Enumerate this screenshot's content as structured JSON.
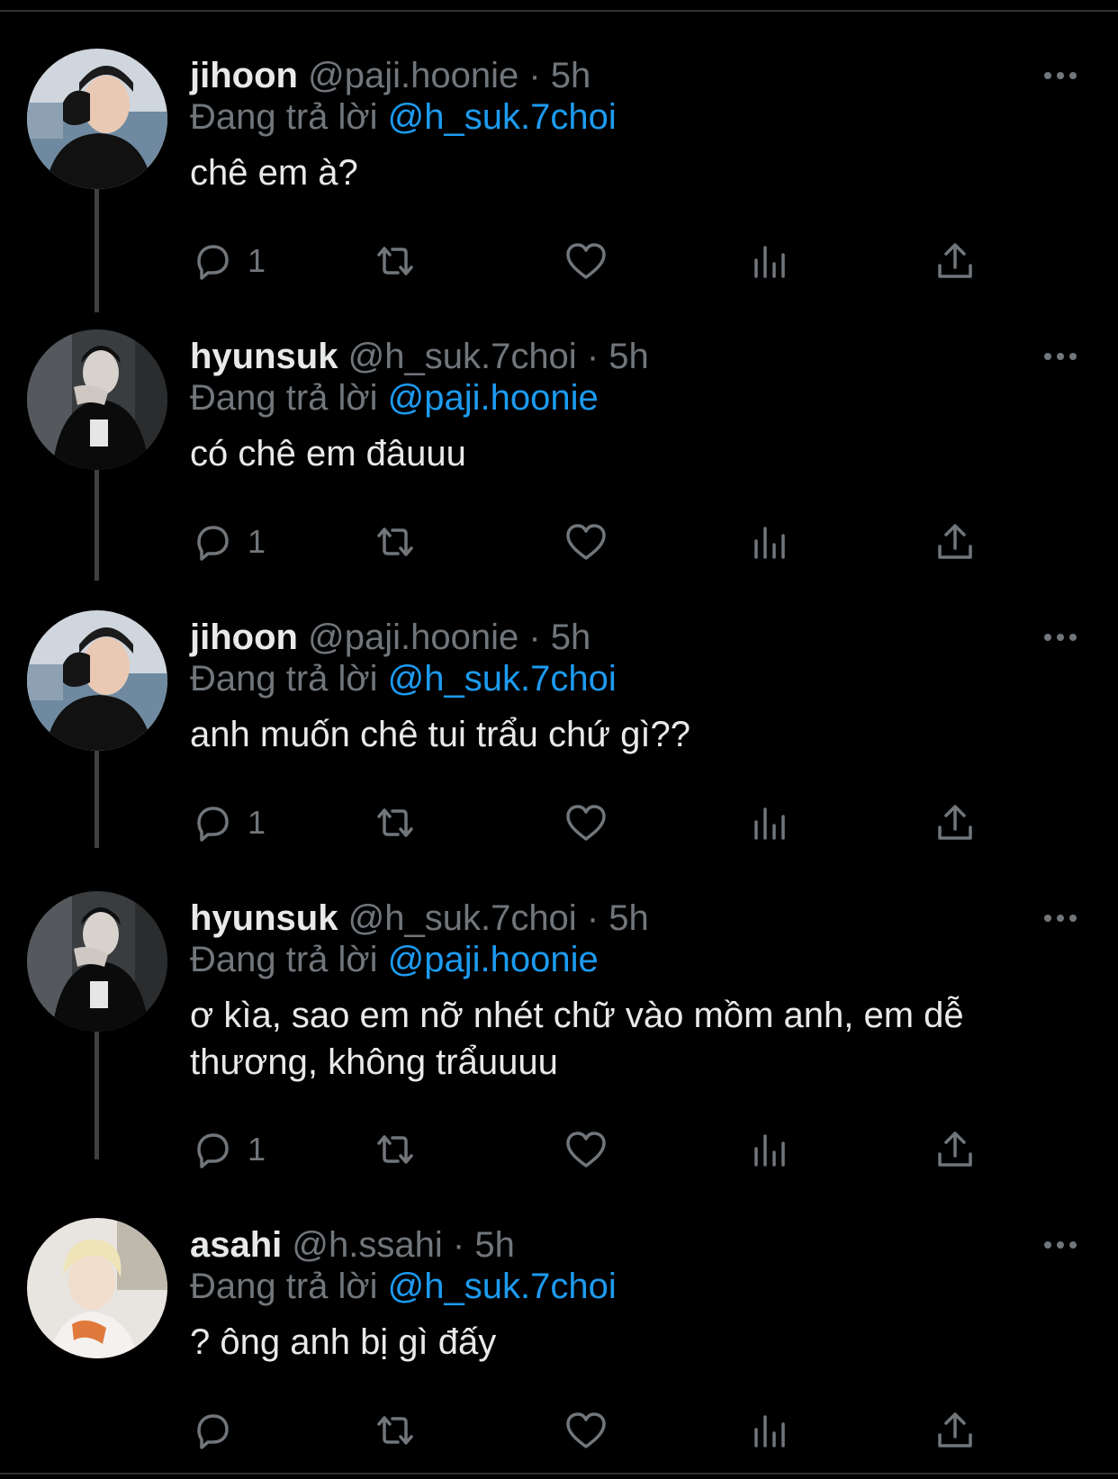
{
  "reply_prefix": "Đang trả lời",
  "tweets": [
    {
      "name": "jihoon",
      "handle": "@paji.hoonie",
      "dot": "·",
      "time": "5h",
      "mention": "@h_suk.7choi",
      "text": "chê em à?",
      "reply_count": "1",
      "avatar": "avatar-jihoon"
    },
    {
      "name": "hyunsuk",
      "handle": "@h_suk.7choi",
      "dot": "·",
      "time": "5h",
      "mention": "@paji.hoonie",
      "text": "có chê em đâuuu",
      "reply_count": "1",
      "avatar": "avatar-hyunsuk"
    },
    {
      "name": "jihoon",
      "handle": "@paji.hoonie",
      "dot": "·",
      "time": "5h",
      "mention": "@h_suk.7choi",
      "text": "anh muốn chê tui trẩu chứ gì??",
      "reply_count": "1",
      "avatar": "avatar-jihoon"
    },
    {
      "name": "hyunsuk",
      "handle": "@h_suk.7choi",
      "dot": "·",
      "time": "5h",
      "mention": "@paji.hoonie",
      "text": "ơ kìa, sao em nỡ nhét chữ vào mồm anh, em dễ thương, không trẩuuuu",
      "reply_count": "1",
      "avatar": "avatar-hyunsuk"
    },
    {
      "name": "asahi",
      "handle": "@h.ssahi",
      "dot": "·",
      "time": "5h",
      "mention": "@h_suk.7choi",
      "text": "? ông anh bị gì đấy",
      "reply_count": "",
      "avatar": "avatar-asahi"
    }
  ],
  "colors": {
    "background": "#000000",
    "text": "#e7e9ea",
    "secondary": "#71767b",
    "mention": "#1d9bf0",
    "thread_line": "#3e4144"
  },
  "icons": {
    "more": "more-horizontal-icon",
    "reply": "reply-bubble-icon",
    "retweet": "retweet-icon",
    "like": "heart-icon",
    "views": "views-bar-chart-icon",
    "share": "share-upload-icon"
  }
}
